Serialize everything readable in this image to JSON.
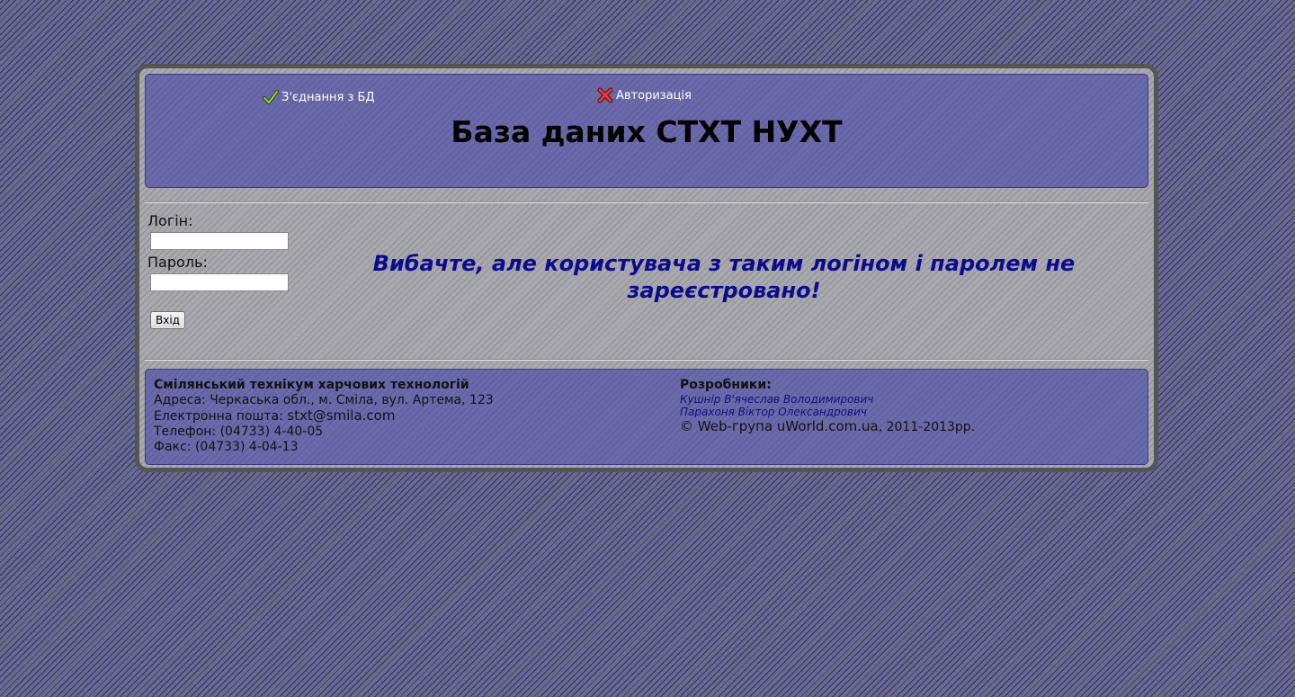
{
  "header": {
    "db_status": "З'єднання з БД",
    "db_status_icon": "checkmark-icon",
    "auth_status": "Авторизація",
    "auth_status_icon": "cross-icon",
    "title": "База даних СТХТ НУХТ"
  },
  "login": {
    "login_label": "Логін:",
    "login_value": "",
    "password_label": "Пароль:",
    "password_value": "",
    "submit_label": "Вхід"
  },
  "message": "Вибачте, але користувача з таким логіном і паролем не зареєстровано!",
  "footer": {
    "org_name": "Смілянський технікум харчових технологій",
    "address": "Адреса: Черкаська обл., м. Сміла, вул. Артема, 123",
    "email_label": "Електронна пошта: ",
    "email": "stxt@smila.com",
    "phone": "Телефон: (04733) 4-40-05",
    "fax": "Факс: (04733) 4-04-13",
    "developers_label": "Розробники:",
    "developers": [
      "Кушнір В'ячеслав Володимирович",
      "Парахоня Віктор Олександрович"
    ],
    "copyright": "© Web-група uWorld.com.ua",
    "years": ", 2011-2013рр."
  },
  "colors": {
    "message": "#0b0b8c",
    "panel": "#6666a8",
    "frame_border": "#555555"
  }
}
